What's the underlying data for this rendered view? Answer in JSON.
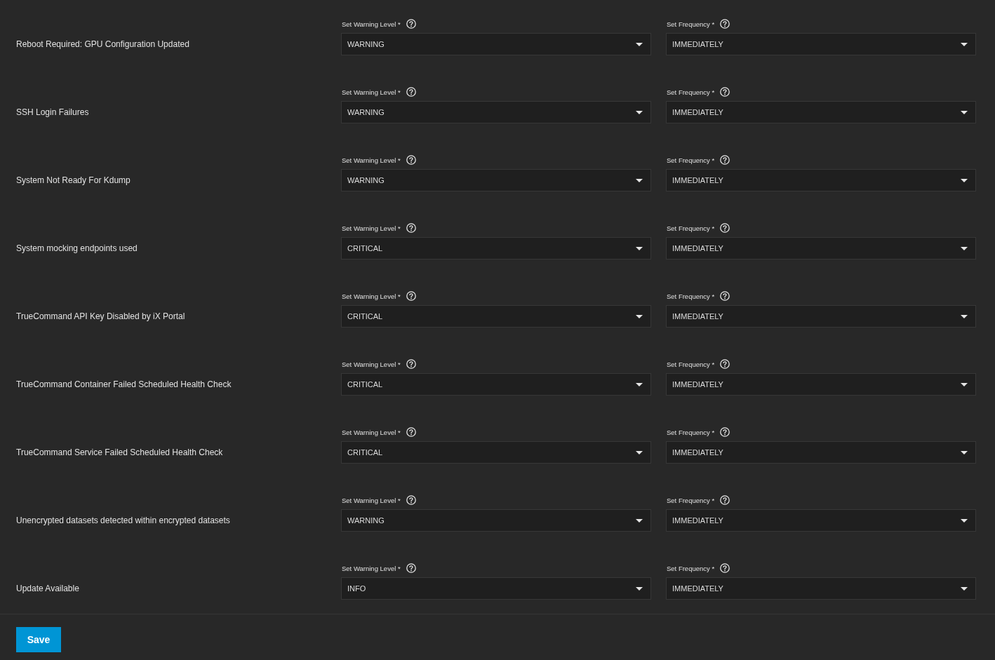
{
  "alerts": [
    {
      "name": "Reboot Required: GPU Configuration Updated",
      "warning_level": {
        "label": "Set Warning Level *",
        "value": "WARNING"
      },
      "frequency": {
        "label": "Set Frequency *",
        "value": "IMMEDIATELY"
      }
    },
    {
      "name": "SSH Login Failures",
      "warning_level": {
        "label": "Set Warning Level *",
        "value": "WARNING"
      },
      "frequency": {
        "label": "Set Frequency *",
        "value": "IMMEDIATELY"
      }
    },
    {
      "name": "System Not Ready For Kdump",
      "warning_level": {
        "label": "Set Warning Level *",
        "value": "WARNING"
      },
      "frequency": {
        "label": "Set Frequency *",
        "value": "IMMEDIATELY"
      }
    },
    {
      "name": "System mocking endpoints used",
      "warning_level": {
        "label": "Set Warning Level *",
        "value": "CRITICAL"
      },
      "frequency": {
        "label": "Set Frequency *",
        "value": "IMMEDIATELY"
      }
    },
    {
      "name": "TrueCommand API Key Disabled by iX Portal",
      "warning_level": {
        "label": "Set Warning Level *",
        "value": "CRITICAL"
      },
      "frequency": {
        "label": "Set Frequency *",
        "value": "IMMEDIATELY"
      }
    },
    {
      "name": "TrueCommand Container Failed Scheduled Health Check",
      "warning_level": {
        "label": "Set Warning Level *",
        "value": "CRITICAL"
      },
      "frequency": {
        "label": "Set Frequency *",
        "value": "IMMEDIATELY"
      }
    },
    {
      "name": "TrueCommand Service Failed Scheduled Health Check",
      "warning_level": {
        "label": "Set Warning Level *",
        "value": "CRITICAL"
      },
      "frequency": {
        "label": "Set Frequency *",
        "value": "IMMEDIATELY"
      }
    },
    {
      "name": "Unencrypted datasets detected within encrypted datasets",
      "warning_level": {
        "label": "Set Warning Level *",
        "value": "WARNING"
      },
      "frequency": {
        "label": "Set Frequency *",
        "value": "IMMEDIATELY"
      }
    },
    {
      "name": "Update Available",
      "warning_level": {
        "label": "Set Warning Level *",
        "value": "INFO"
      },
      "frequency": {
        "label": "Set Frequency *",
        "value": "IMMEDIATELY"
      }
    }
  ],
  "save_button": "Save"
}
